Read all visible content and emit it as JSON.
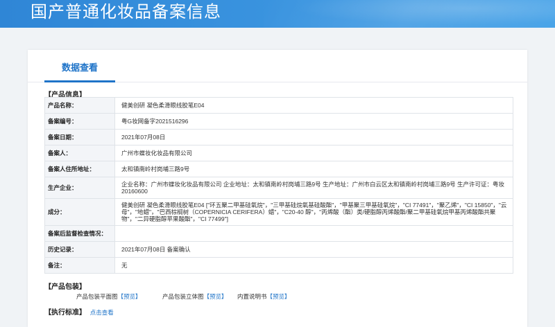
{
  "header": {
    "title": "国产普通化妆品备案信息"
  },
  "tabs": [
    {
      "label": "数据查看"
    }
  ],
  "product_info": {
    "section_title": "【产品信息】",
    "rows": [
      {
        "label": "产品名称：",
        "value": "健美创研 凝色柔滑眼线胶笔E04"
      },
      {
        "label": "备案编号：",
        "value": "粤G妆网备字2021516296"
      },
      {
        "label": "备案日期：",
        "value": "2021年07月08日"
      },
      {
        "label": "备案人：",
        "value": "广州市蝶妆化妆品有限公司"
      },
      {
        "label": "备案人住所地址：",
        "value": "太和镇南岭村岗埔三路9号"
      },
      {
        "label": "生产企业：",
        "value": "企业名称：广州市蝶妆化妆品有限公司 企业地址：太和镇南岭村岗埔三路9号 生产地址：广州市白云区太和镇南岭村岗埔三路9号 生产许可证：粤妆 20160600"
      },
      {
        "label": "成分：",
        "value": "健美创研 凝色柔滑眼线胶笔E04 [\"环五聚二甲基硅氧烷\"，\"三甲基硅烷氧基硅酸酯\"，\"甲基聚三甲基硅氧烷\"，\"CI 77491\"，\"聚乙烯\"，\"CI 15850\"，\"云母\"，\"地蜡\"，\"巴西棕榈树（COPERNICIA CERIFERA）蜡\"，\"C20-40 醇\"，\"丙烯酸（酯）类/硬脂醇丙烯酸酯/聚二甲基硅氧烷甲基丙烯酸酯共聚物\"，\"二异硬脂醇苹果酸酯\"，\"CI 77499\"]"
      },
      {
        "label": "备案后监督检查情况：",
        "value": ""
      },
      {
        "label": "历史记录：",
        "value": "2021年07月08日 备案确认"
      },
      {
        "label": "备注：",
        "value": "无"
      }
    ]
  },
  "packaging": {
    "section_title": "【产品包装】",
    "items": [
      {
        "label": "产品包装平面图",
        "link": "【预览】"
      },
      {
        "label": "产品包装立体图",
        "link": "【预览】"
      },
      {
        "label": "内置说明书",
        "link": "【预览】"
      }
    ]
  },
  "standard": {
    "section_title": "【执行标准】",
    "link": "点击查看"
  }
}
